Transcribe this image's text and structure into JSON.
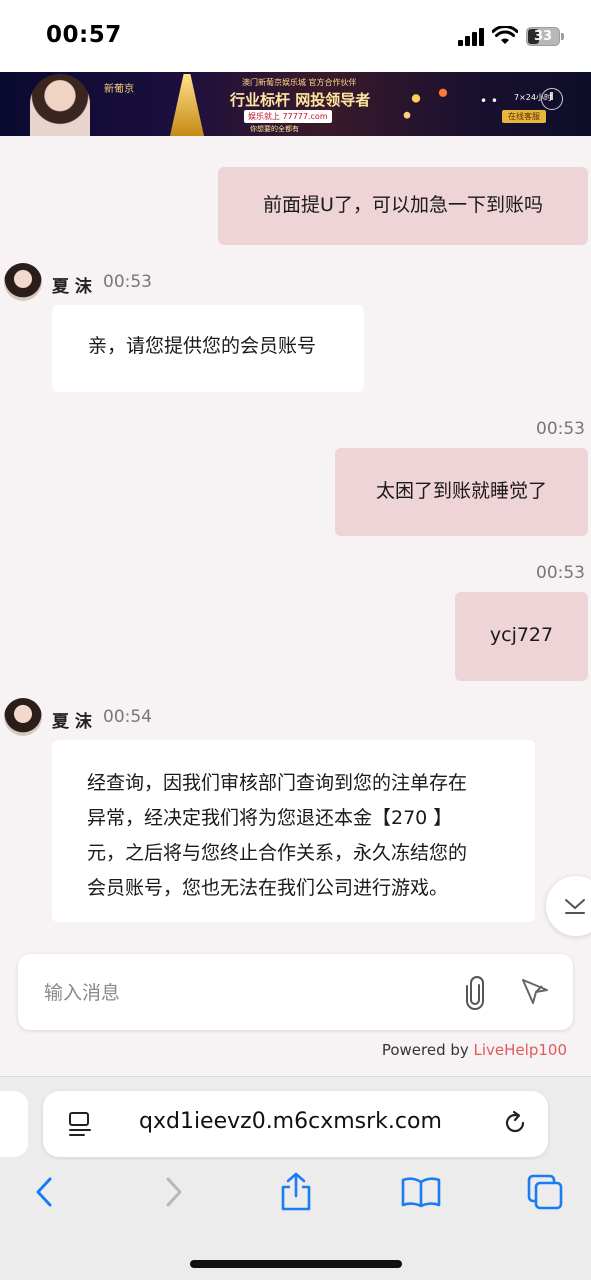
{
  "status_bar": {
    "time": "00:57",
    "battery": "33",
    "battery_level": 0.33
  },
  "banner": {
    "logo": "新葡京",
    "subline": "澳门新葡京娱乐城 官方合作伙伴",
    "headline": "行业标杆 网投领导者",
    "tag": "娱乐就上 77777.com",
    "slogan": "你想要的全都有",
    "support": "7×24小时",
    "online": "在线客服"
  },
  "agent": {
    "name": "夏 沫"
  },
  "messages": [
    {
      "from": "user",
      "text": "前面提U了，可以加急一下到账吗"
    },
    {
      "from": "agent",
      "time": "00:53",
      "text": "亲，请您提供您的会员账号"
    },
    {
      "from": "user",
      "time": "00:53",
      "text": "太困了到账就睡觉了"
    },
    {
      "from": "user",
      "time": "00:53",
      "text": "ycj727"
    },
    {
      "from": "agent",
      "time": "00:54",
      "lines": [
        "经查询，因我们审核部门查询到您的注单存在",
        "异常，经决定我们将为您退还本金【270 】",
        "元，之后将与您终止合作关系，永久冻结您的",
        "会员账号，您也无法在我们公司进行游戏。"
      ]
    }
  ],
  "input": {
    "placeholder": "输入消息",
    "value": ""
  },
  "powered": {
    "prefix": "Powered by ",
    "brand": "LiveHelp100"
  },
  "browser": {
    "url": "qxd1ieevz0.m6cxmsrk.com"
  },
  "icons": {
    "signal": "signal-icon",
    "wifi": "wifi-icon",
    "battery": "battery-icon",
    "attach": "paperclip-icon",
    "send": "send-icon",
    "scroll": "chevron-down-icon",
    "reader": "reader-mode-icon",
    "reload": "reload-icon",
    "back": "back-arrow-icon",
    "forward": "forward-arrow-icon",
    "share": "share-icon",
    "bookmarks": "bookmarks-icon",
    "tabs": "tabs-icon"
  },
  "colors": {
    "user_bubble": "#eed3d7",
    "agent_bubble": "#ffffff",
    "chat_bg": "#f7f3f4",
    "brand_accent": "#e05a5a",
    "browser_blue": "#1a7cf0"
  }
}
